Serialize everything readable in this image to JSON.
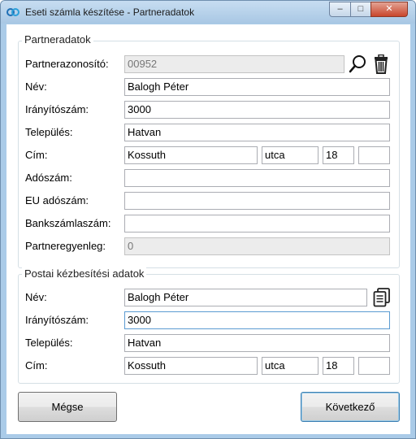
{
  "window": {
    "title": "Eseti számla készítése - Partneradatok"
  },
  "partner": {
    "legend": "Partneradatok",
    "fields": {
      "id": {
        "label": "Partnerazonosító:",
        "value": "00952"
      },
      "name": {
        "label": "Név:",
        "value": "Balogh Péter"
      },
      "zip": {
        "label": "Irányítószám:",
        "value": "3000"
      },
      "city": {
        "label": "Település:",
        "value": "Hatvan"
      },
      "address": {
        "label": "Cím:",
        "street": "Kossuth",
        "type": "utca",
        "number": "18",
        "extra": ""
      },
      "tax": {
        "label": "Adószám:",
        "value": ""
      },
      "eutax": {
        "label": "EU adószám:",
        "value": ""
      },
      "bank": {
        "label": "Bankszámlaszám:",
        "value": ""
      },
      "balance": {
        "label": "Partneregyenleg:",
        "value": "0"
      }
    }
  },
  "postal": {
    "legend": "Postai kézbesítési adatok",
    "fields": {
      "name": {
        "label": "Név:",
        "value": "Balogh Péter"
      },
      "zip": {
        "label": "Irányítószám:",
        "value": "3000"
      },
      "city": {
        "label": "Település:",
        "value": "Hatvan"
      },
      "address": {
        "label": "Cím:",
        "street": "Kossuth",
        "type": "utca",
        "number": "18",
        "extra": ""
      }
    }
  },
  "buttons": {
    "cancel": "Mégse",
    "next": "Következő"
  },
  "icons": {
    "search": "search-icon",
    "delete": "trash-icon",
    "copy": "copy-icon",
    "app": "app-icon"
  }
}
